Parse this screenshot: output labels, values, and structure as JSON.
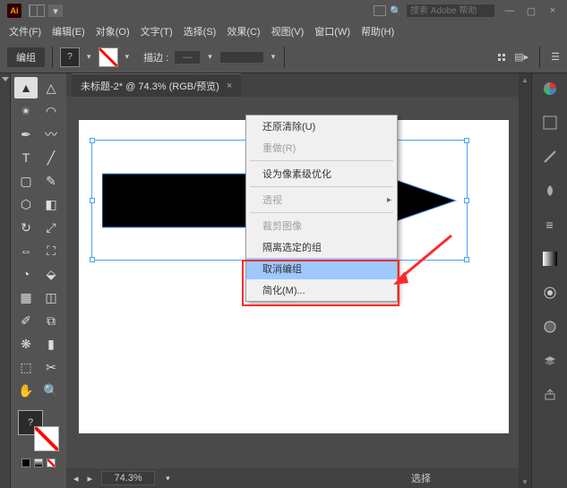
{
  "search": {
    "placeholder": "搜索 Adobe 帮助"
  },
  "menu": {
    "file": "文件(F)",
    "edit": "编辑(E)",
    "object": "对象(O)",
    "type": "文字(T)",
    "select": "选择(S)",
    "effect": "效果(C)",
    "view": "视图(V)",
    "window": "窗口(W)",
    "help": "帮助(H)"
  },
  "ctrl": {
    "mode": "编组",
    "stroke_label": "描边 :",
    "stroke_dash": "—"
  },
  "doc": {
    "title": "未标题-2* @ 74.3% (RGB/预览)"
  },
  "ctx": {
    "undo": "还原清除(U)",
    "redo": "重做(R)",
    "pixel": "设为像素级优化",
    "perspective": "透视",
    "crop": "裁剪图像",
    "isolate": "隔离选定的组",
    "ungroup": "取消编组",
    "simplify": "简化(M)..."
  },
  "status": {
    "zoom": "74.3%",
    "select": "选择"
  }
}
